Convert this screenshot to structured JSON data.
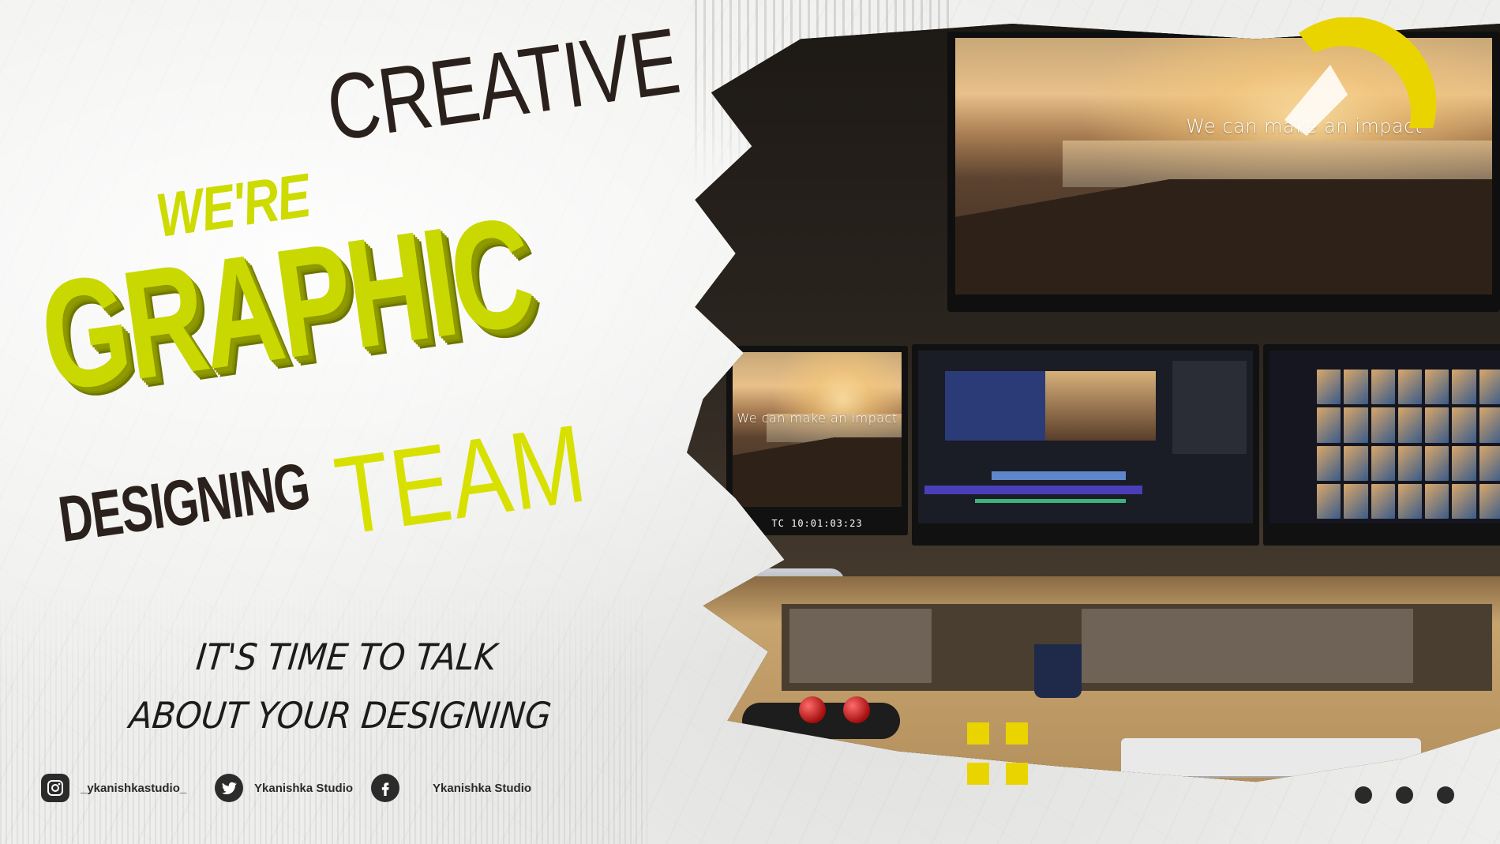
{
  "headline": {
    "line1_prefix": "WE'RE",
    "line1_word": "CREATIVE",
    "line2": "GRAPHIC",
    "line3_word": "DESIGNING",
    "line3_suffix": "TEAM"
  },
  "tagline": {
    "line1": "IT'S TIME TO TALK",
    "line2": "ABOUT YOUR DESIGNING"
  },
  "photo": {
    "screen_caption_large": "We can make an impact",
    "screen_caption_small": "We can make an impact",
    "timecode": "TC 10:01:03:23"
  },
  "social": [
    {
      "icon": "instagram-icon",
      "handle": "_ykanishkastudio_"
    },
    {
      "icon": "twitter-icon",
      "handle": "Ykanishka Studio"
    },
    {
      "icon": "facebook-icon",
      "handle": "Ykanishka Studio"
    }
  ],
  "colors": {
    "accent": "#cddb00",
    "dark": "#2b211c",
    "highlight": "#e9d400"
  },
  "pager_dots": 3
}
